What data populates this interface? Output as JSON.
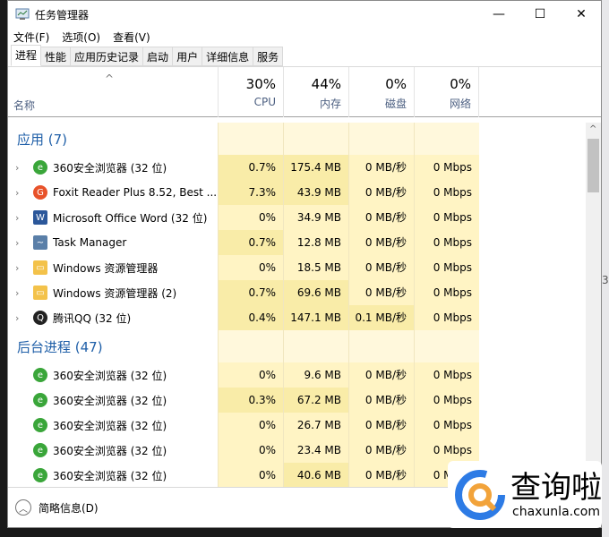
{
  "window": {
    "title": "任务管理器",
    "minimize": "—",
    "maximize": "☐",
    "close": "✕"
  },
  "menu": [
    "文件(F)",
    "选项(O)",
    "查看(V)"
  ],
  "tabs": [
    "进程",
    "性能",
    "应用历史记录",
    "启动",
    "用户",
    "详细信息",
    "服务"
  ],
  "header": {
    "name_label": "名称",
    "sort_arrow": "^",
    "columns": [
      {
        "percent": "30%",
        "label": "CPU"
      },
      {
        "percent": "44%",
        "label": "内存"
      },
      {
        "percent": "0%",
        "label": "磁盘"
      },
      {
        "percent": "0%",
        "label": "网络"
      }
    ]
  },
  "groups": [
    {
      "title": "应用 (7)",
      "rows": [
        {
          "name": "360安全浏览器 (32 位)",
          "icon": "ie-green",
          "cpu": "0.7%",
          "mem": "175.4 MB",
          "disk": "0 MB/秒",
          "net": "0 Mbps"
        },
        {
          "name": "Foxit Reader Plus 8.52, Best ...",
          "icon": "foxit",
          "cpu": "7.3%",
          "mem": "43.9 MB",
          "disk": "0 MB/秒",
          "net": "0 Mbps"
        },
        {
          "name": "Microsoft Office Word (32 位)",
          "icon": "word",
          "cpu": "0%",
          "mem": "34.9 MB",
          "disk": "0 MB/秒",
          "net": "0 Mbps"
        },
        {
          "name": "Task Manager",
          "icon": "taskmgr",
          "cpu": "0.7%",
          "mem": "12.8 MB",
          "disk": "0 MB/秒",
          "net": "0 Mbps"
        },
        {
          "name": "Windows 资源管理器",
          "icon": "folder",
          "cpu": "0%",
          "mem": "18.5 MB",
          "disk": "0 MB/秒",
          "net": "0 Mbps"
        },
        {
          "name": "Windows 资源管理器 (2)",
          "icon": "folder",
          "cpu": "0.7%",
          "mem": "69.6 MB",
          "disk": "0 MB/秒",
          "net": "0 Mbps"
        },
        {
          "name": "腾讯QQ (32 位)",
          "icon": "qq",
          "cpu": "0.4%",
          "mem": "147.1 MB",
          "disk": "0.1 MB/秒",
          "net": "0 Mbps"
        }
      ]
    },
    {
      "title": "后台进程 (47)",
      "rows": [
        {
          "name": "360安全浏览器 (32 位)",
          "icon": "ie-green",
          "cpu": "0%",
          "mem": "9.6 MB",
          "disk": "0 MB/秒",
          "net": "0 Mbps"
        },
        {
          "name": "360安全浏览器 (32 位)",
          "icon": "ie-green",
          "cpu": "0.3%",
          "mem": "67.2 MB",
          "disk": "0 MB/秒",
          "net": "0 Mbps"
        },
        {
          "name": "360安全浏览器 (32 位)",
          "icon": "ie-green",
          "cpu": "0%",
          "mem": "26.7 MB",
          "disk": "0 MB/秒",
          "net": "0 Mbps"
        },
        {
          "name": "360安全浏览器 (32 位)",
          "icon": "ie-green",
          "cpu": "0%",
          "mem": "23.4 MB",
          "disk": "0 MB/秒",
          "net": "0 Mbps"
        },
        {
          "name": "360安全浏览器 (32 位)",
          "icon": "ie-green",
          "cpu": "0%",
          "mem": "40.6 MB",
          "disk": "0 MB/秒",
          "net": "0 Mbps"
        }
      ]
    }
  ],
  "footer": {
    "label": "简略信息(D)"
  },
  "watermark": {
    "text": "查询啦",
    "url": "chaxunla.com"
  },
  "outside_text": "3"
}
